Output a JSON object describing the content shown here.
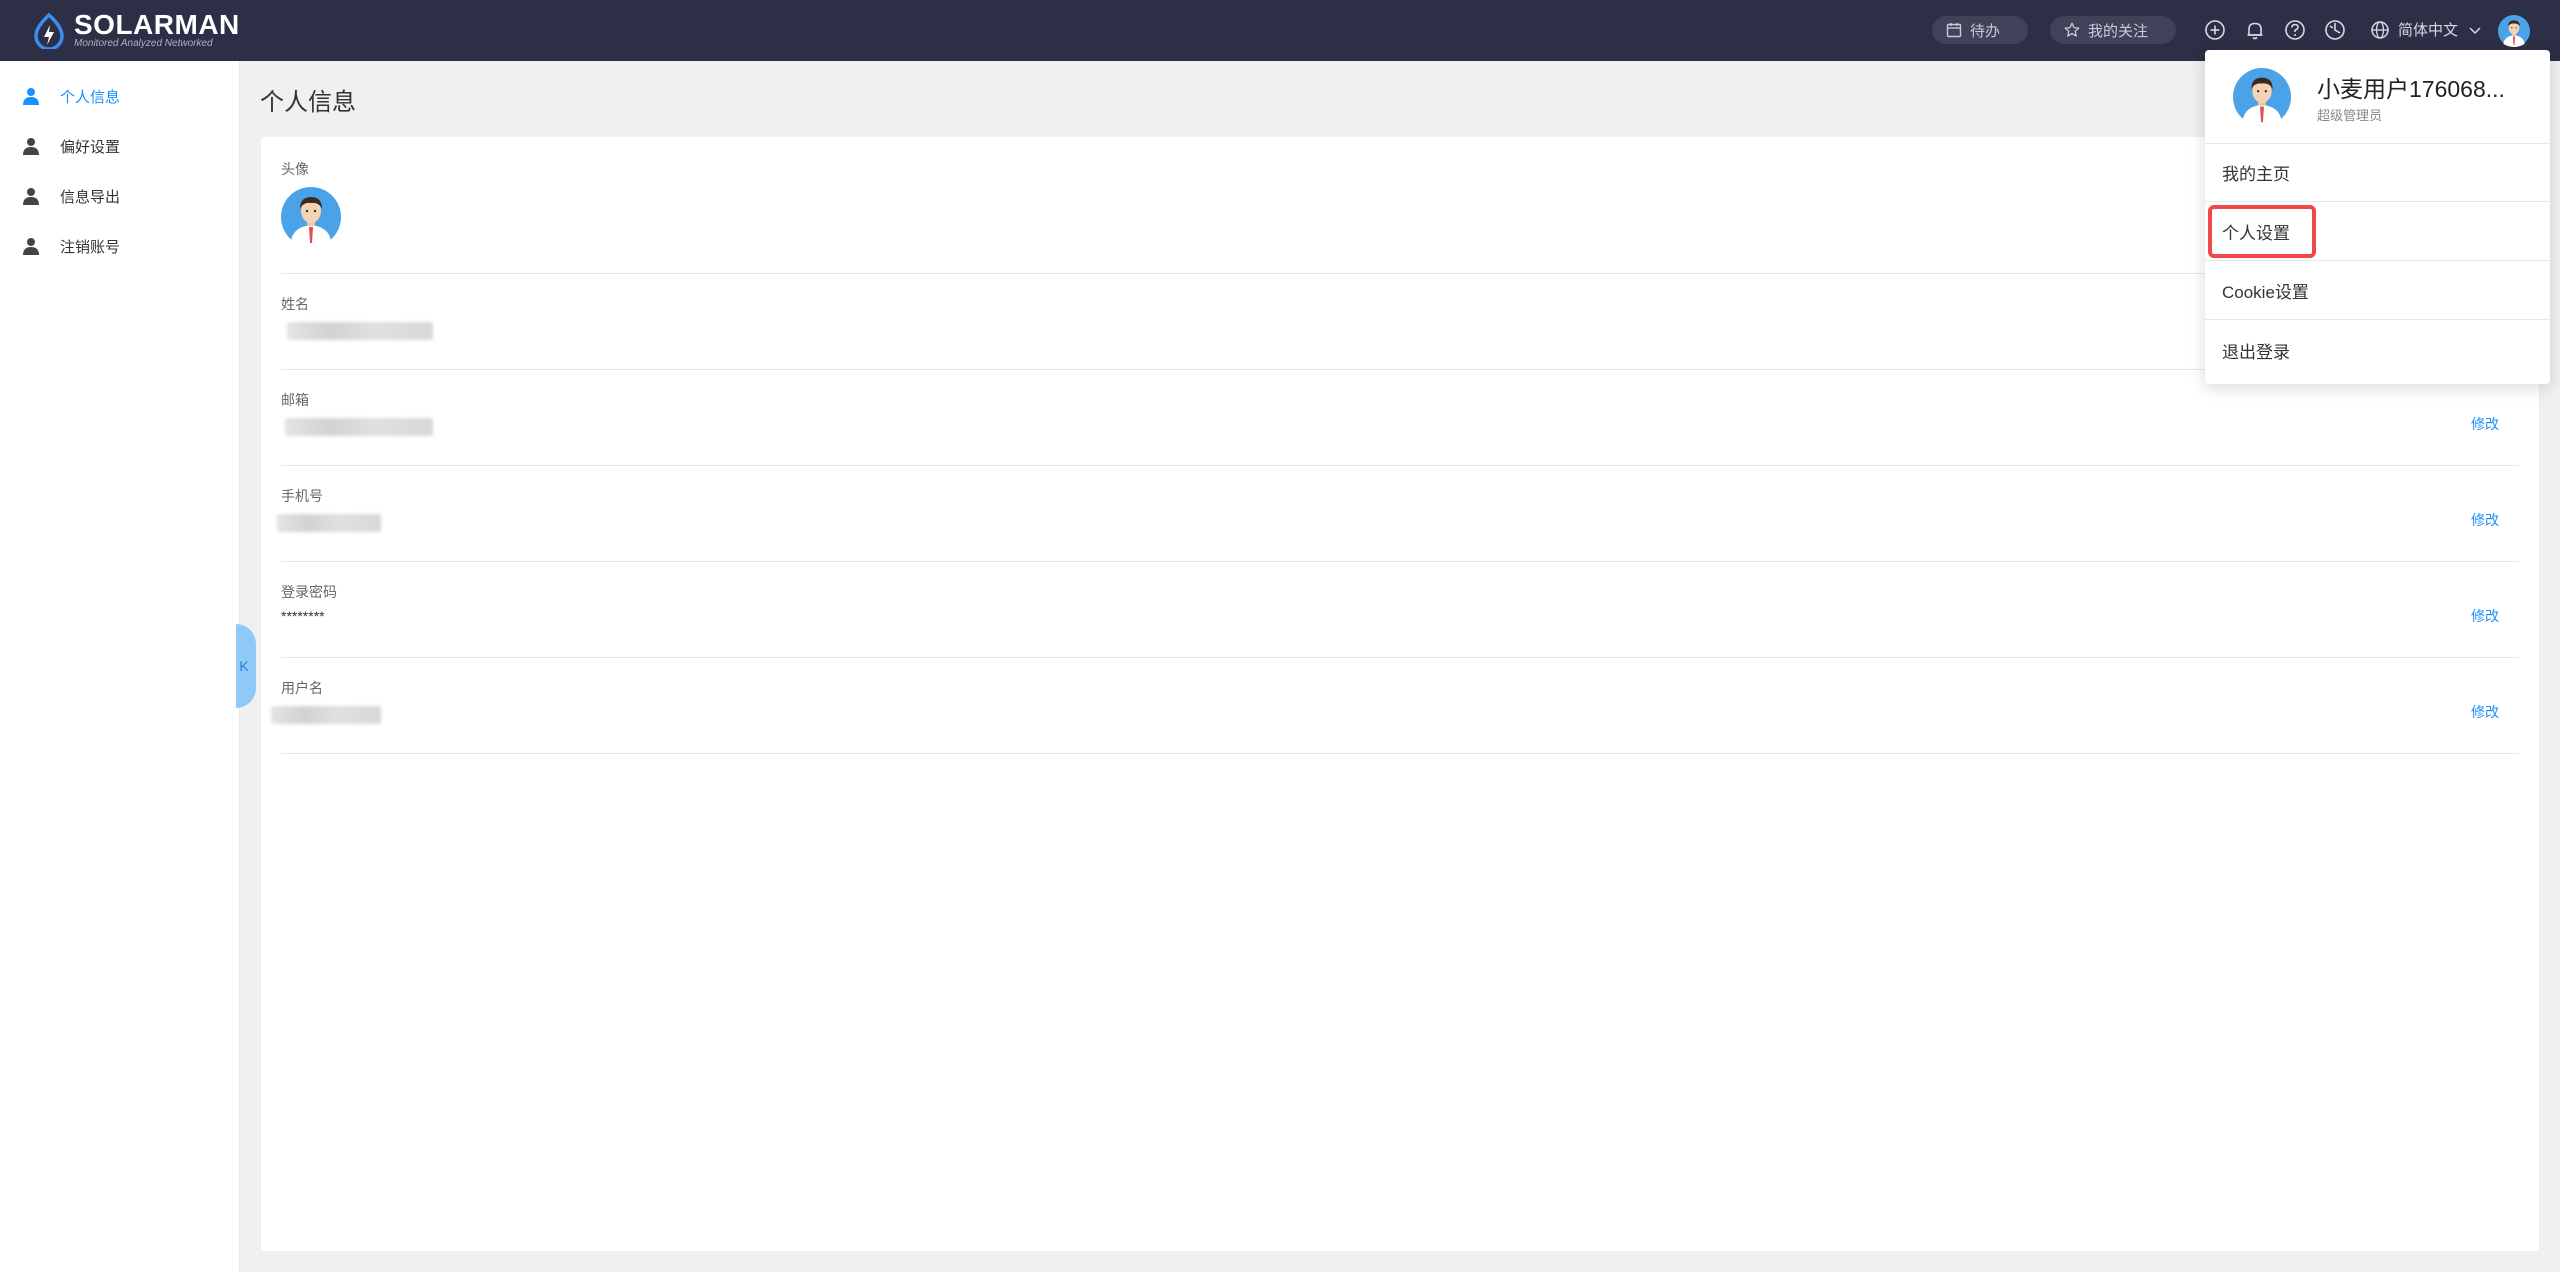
{
  "header": {
    "logo_title": "SOLARMAN",
    "logo_subtitle": "Monitored Analyzed Networked",
    "todo_label": "待办",
    "favorites_label": "我的关注",
    "language": "简体中文",
    "icons": [
      "add-icon",
      "bell-icon",
      "help-icon",
      "dashboard-icon",
      "globe-icon"
    ],
    "colors": {
      "background": "#2c2f45",
      "pill": "#3f4258"
    }
  },
  "sidebar": {
    "items": [
      {
        "label": "个人信息",
        "active": true
      },
      {
        "label": "偏好设置",
        "active": false
      },
      {
        "label": "信息导出",
        "active": false
      },
      {
        "label": "注销账号",
        "active": false
      }
    ],
    "collapse_label": "K",
    "accent": "#1890ff"
  },
  "main": {
    "title": "个人信息",
    "fields": {
      "avatar_label": "头像",
      "name_label": "姓名",
      "email_label": "邮箱",
      "email_edit": "修改",
      "phone_label": "手机号",
      "phone_edit": "修改",
      "password_label": "登录密码",
      "password_value": "********",
      "password_edit": "修改",
      "username_label": "用户名",
      "username_edit": "修改"
    }
  },
  "dropdown": {
    "user_name": "小麦用户176068...",
    "user_role": "超级管理员",
    "items": [
      {
        "label": "我的主页",
        "highlighted": false
      },
      {
        "label": "个人设置",
        "highlighted": true
      },
      {
        "label": "Cookie设置",
        "highlighted": false
      },
      {
        "label": "退出登录",
        "highlighted": false
      }
    ],
    "highlight_color": "#f04848"
  }
}
